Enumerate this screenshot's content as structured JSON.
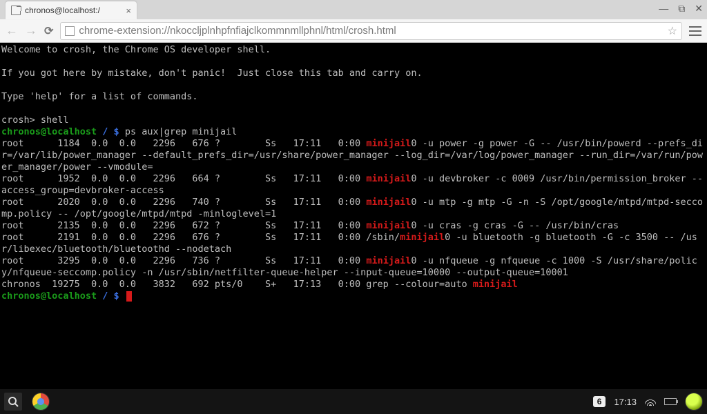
{
  "browser": {
    "tab_title": "chronos@localhost:/",
    "url": "chrome-extension://nkoccljplnhpfnfiajclkommnmllphnl/html/crosh.html"
  },
  "terminal": {
    "welcome1": "Welcome to crosh, the Chrome OS developer shell.",
    "welcome2": "If you got here by mistake, don't panic!  Just close this tab and carry on.",
    "welcome3": "Type 'help' for a list of commands.",
    "crosh_prompt": "crosh> shell",
    "ps_host": "chronos@localhost",
    "ps_sep": " / $ ",
    "ps_cmd": "ps aux|grep minijail",
    "hl": "minijail",
    "line_r1a": "root      1184  0.0  0.0   2296   676 ?        Ss   17:11   0:00 ",
    "line_r1b": "0 -u power -g power -G -- /usr/bin/powerd --prefs_dir=/var/lib/power_manager --default_prefs_dir=/usr/share/power_manager --log_dir=/var/log/power_manager --run_dir=/var/run/power_manager/power --vmodule=",
    "line_r2a": "root      1952  0.0  0.0   2296   664 ?        Ss   17:11   0:00 ",
    "line_r2b": "0 -u devbroker -c 0009 /usr/bin/permission_broker --access_group=devbroker-access",
    "line_r3a": "root      2020  0.0  0.0   2296   740 ?        Ss   17:11   0:00 ",
    "line_r3b": "0 -u mtp -g mtp -G -n -S /opt/google/mtpd/mtpd-seccomp.policy -- /opt/google/mtpd/mtpd -minloglevel=1",
    "line_r4a": "root      2135  0.0  0.0   2296   672 ?        Ss   17:11   0:00 ",
    "line_r4b": "0 -u cras -g cras -G -- /usr/bin/cras",
    "line_r5a": "root      2191  0.0  0.0   2296   676 ?        Ss   17:11   0:00 /sbin/",
    "line_r5b": "0 -u bluetooth -g bluetooth -G -c 3500 -- /usr/libexec/bluetooth/bluetoothd --nodetach",
    "line_r6a": "root      3295  0.0  0.0   2296   736 ?        Ss   17:11   0:00 ",
    "line_r6b": "0 -u nfqueue -g nfqueue -c 1000 -S /usr/share/policy/nfqueue-seccomp.policy -n /usr/sbin/netfilter-queue-helper --input-queue=10000 --output-queue=10001",
    "line_r7a": "chronos  19275  0.0  0.0   3832   692 pts/0    S+   17:13   0:00 grep --colour=auto ",
    "prompt2_host": "chronos@localhost",
    "prompt2_sep": " / $ "
  },
  "shelf": {
    "badge": "6",
    "clock": "17:13"
  }
}
